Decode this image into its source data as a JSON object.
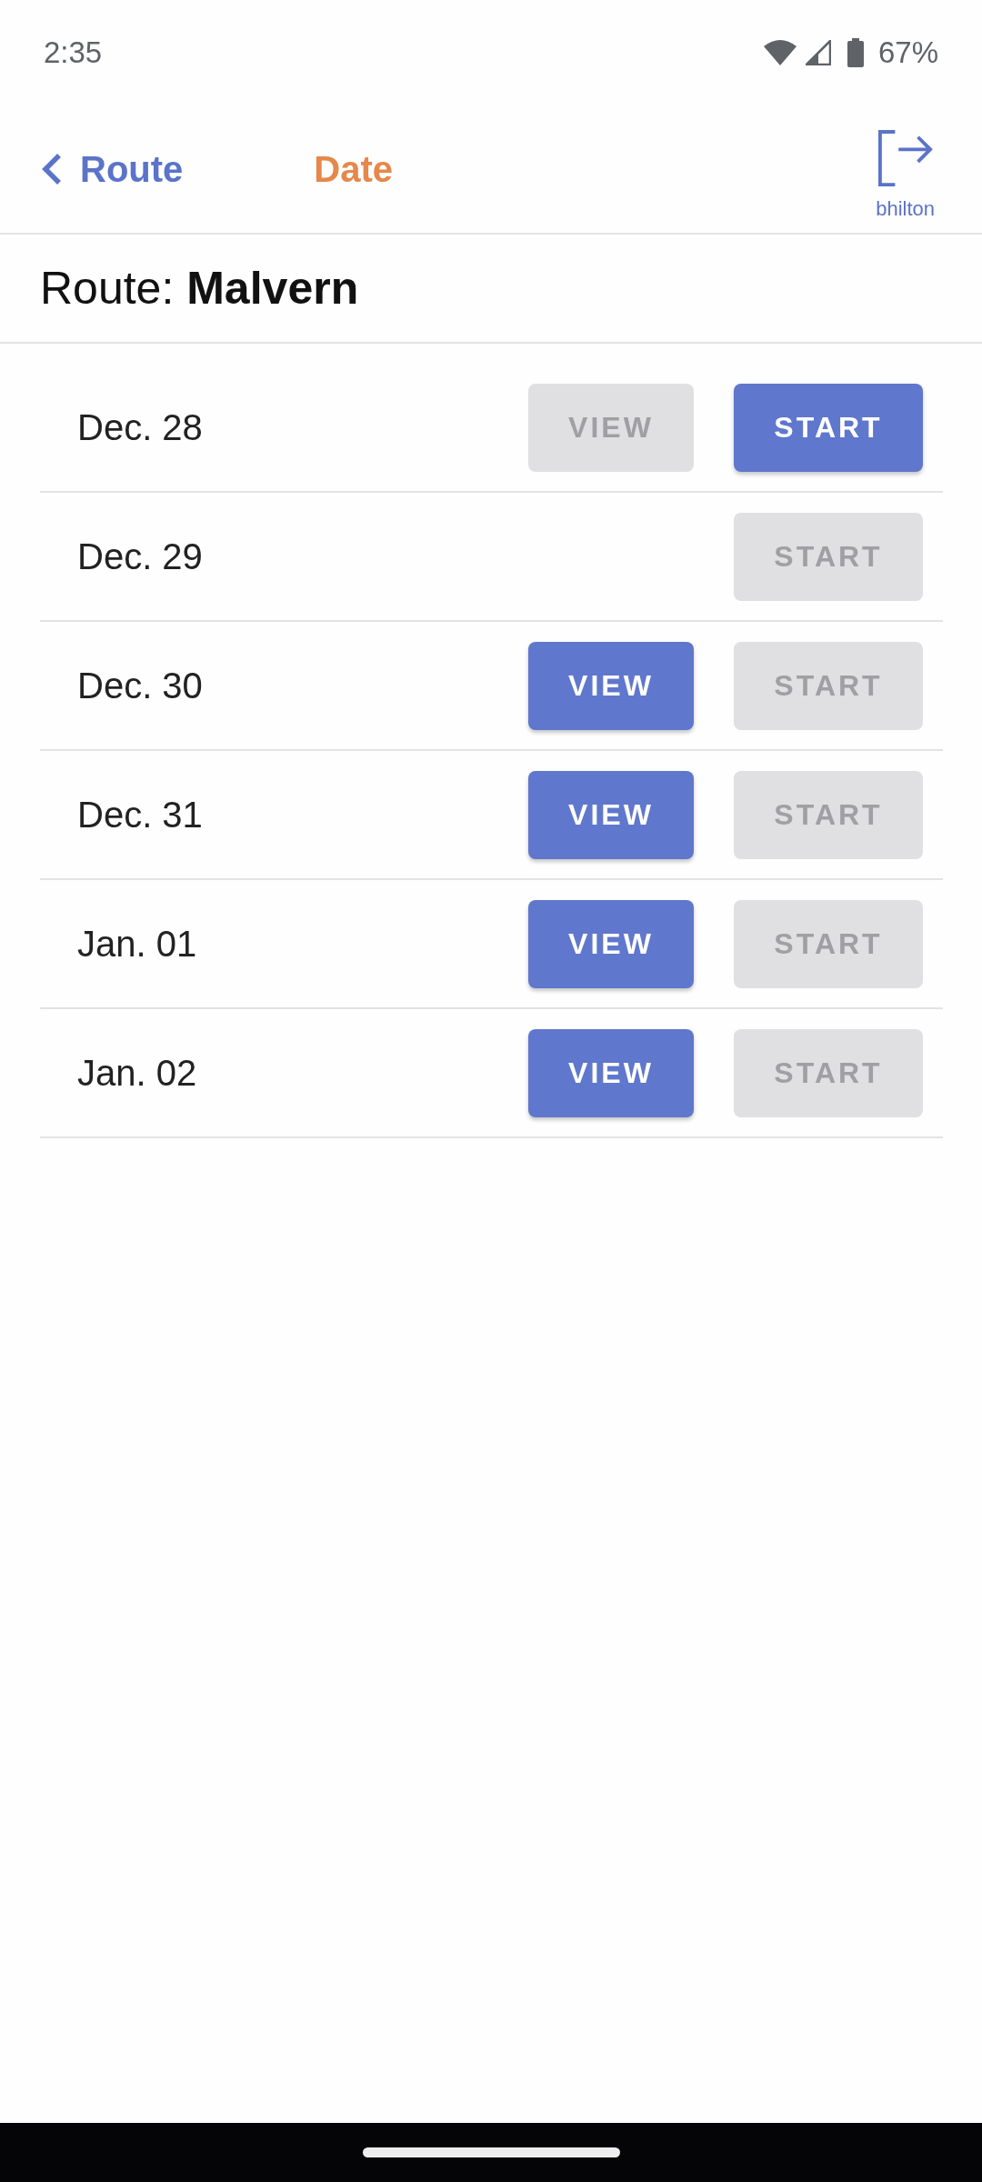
{
  "status_bar": {
    "time": "2:35",
    "battery": "67%"
  },
  "header": {
    "back": {
      "label": "Route"
    },
    "title": "Date",
    "user": {
      "name": "bhilton"
    }
  },
  "route": {
    "text": "Route: **Malvern**"
  },
  "dates": [
    {
      "date": "Dec. 28",
      "view": {
        "label": "VIEW",
        "disabled": true
      },
      "start": {
        "label": "START",
        "disabled": false
      }
    },
    {
      "date": "Dec. 29",
      "start": {
        "label": "START",
        "disabled": true
      }
    },
    {
      "date": "Dec. 30",
      "view": {
        "label": "VIEW",
        "disabled": false
      },
      "start": {
        "label": "START",
        "disabled": true
      }
    },
    {
      "date": "Dec. 31",
      "view": {
        "label": "VIEW",
        "disabled": false
      },
      "start": {
        "label": "START",
        "disabled": true
      }
    },
    {
      "date": "Jan. 01",
      "view": {
        "label": "VIEW",
        "disabled": false
      },
      "start": {
        "label": "START",
        "disabled": true
      }
    },
    {
      "date": "Jan. 02",
      "view": {
        "label": "VIEW",
        "disabled": false
      },
      "start": {
        "label": "START",
        "disabled": true
      }
    }
  ]
}
